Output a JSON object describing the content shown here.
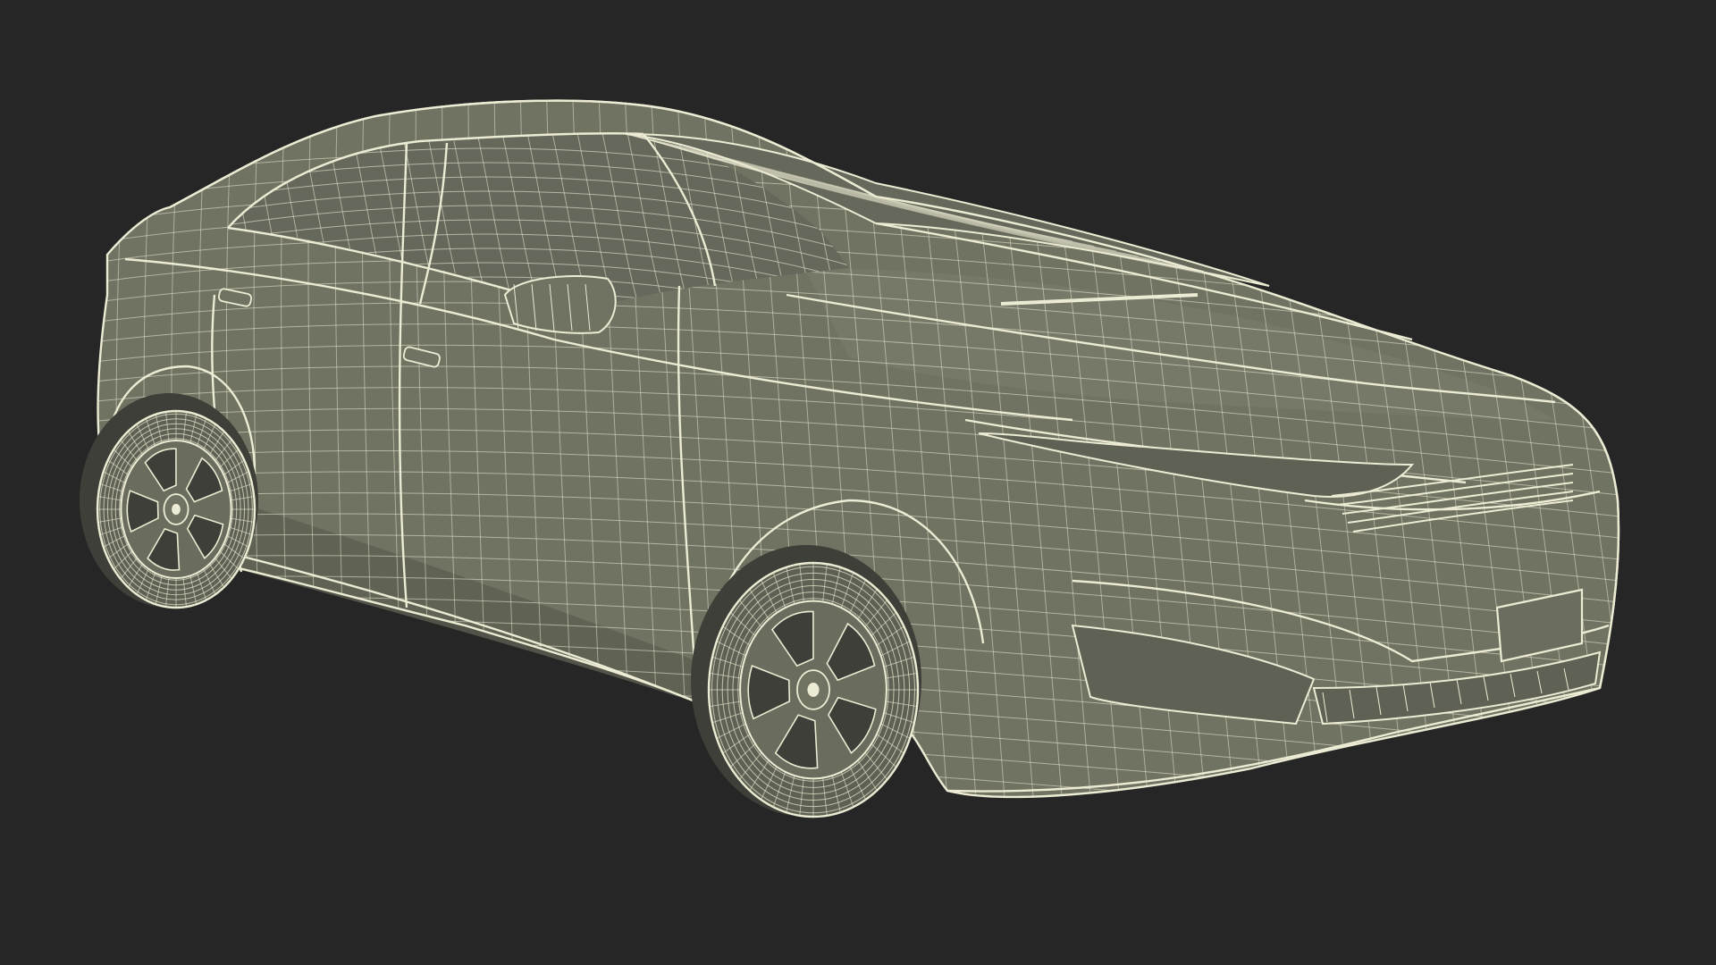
{
  "scene": {
    "subject": "car-wireframe",
    "colors": {
      "background": "#262626",
      "body_fill": "#707262",
      "body_shadow": "#5c5e51",
      "glass_fill": "#65685a",
      "wire": "#ecebd3",
      "wire_dim": "#c9c8b2",
      "tire_fill": "#5e6053",
      "dark_fill": "#3e3f38"
    }
  }
}
